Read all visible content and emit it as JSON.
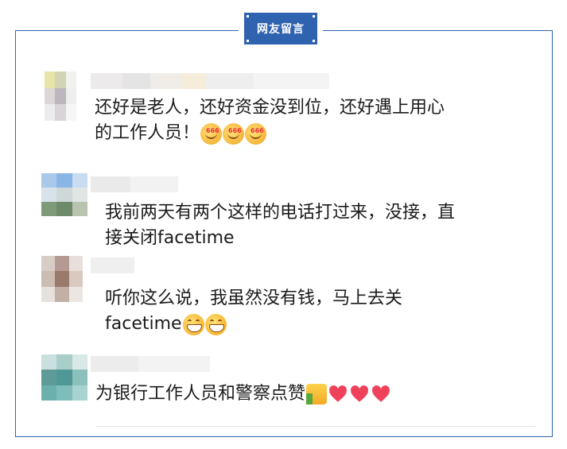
{
  "header": {
    "badge_label": "网友留言"
  },
  "colors": {
    "accent": "#2f63b0",
    "text": "#1b1b1b",
    "heart": "#f0415b"
  },
  "comments": [
    {
      "line1": "还好是老人，还好资金没到位，还好遇上用心",
      "line2": "的工作人员！",
      "emojis": [
        "666-emoji",
        "666-emoji",
        "666-emoji"
      ],
      "emoji_caption": "666"
    },
    {
      "line1": "我前两天有两个这样的电话打过来，没接，直",
      "line2": "接关闭facetime",
      "emojis": []
    },
    {
      "line1": "听你这么说，我虽然没有钱，马上去关",
      "line2": "facetime",
      "emojis": [
        "grin-emoji",
        "grin-emoji"
      ]
    },
    {
      "line1": "为银行工作人员和警察点赞",
      "line2": "",
      "emojis": [
        "thumbs-up-emoji",
        "heart-emoji",
        "heart-emoji",
        "heart-emoji"
      ]
    }
  ]
}
